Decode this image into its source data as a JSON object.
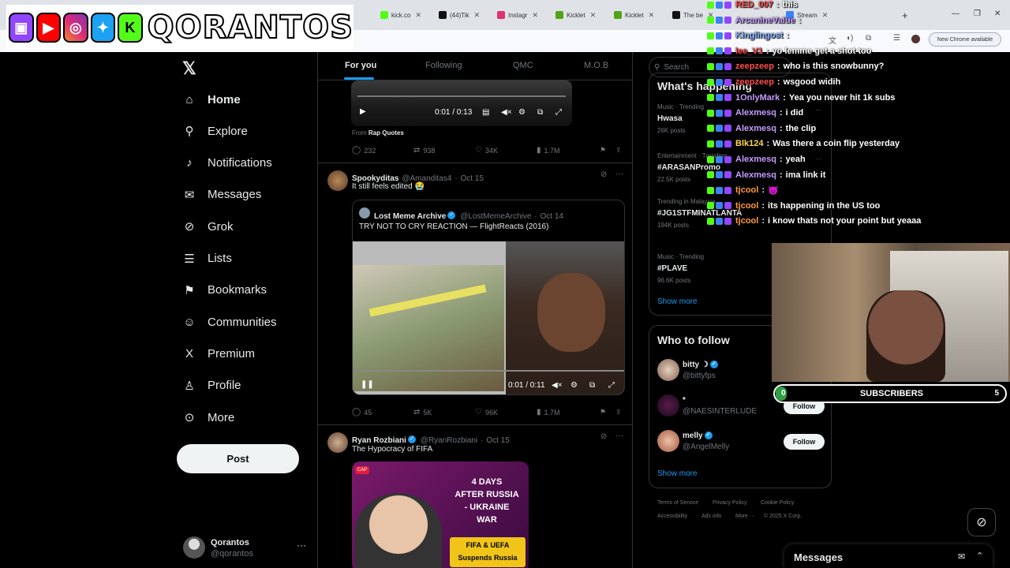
{
  "browser": {
    "tabs": [
      {
        "title": "kick.co",
        "color": "#53fc18"
      },
      {
        "title": "(44)Tik",
        "color": "#111111"
      },
      {
        "title": "Instagr",
        "color": "#e1306c"
      },
      {
        "title": "Kicklet",
        "color": "#53a318"
      },
      {
        "title": "Kicklet",
        "color": "#53a318"
      },
      {
        "title": "The be",
        "color": "#111111"
      },
      {
        "title": "Stream",
        "color": "#3b82f6"
      }
    ],
    "new_chrome_label": "New Chrome available"
  },
  "stream_overlay": {
    "logo_text": "QORANTOS"
  },
  "nav": {
    "items": [
      {
        "label": "Home",
        "icon": "home-icon",
        "glyph": "⌂"
      },
      {
        "label": "Explore",
        "icon": "search-icon",
        "glyph": "⚲"
      },
      {
        "label": "Notifications",
        "icon": "bell-icon",
        "glyph": "♪"
      },
      {
        "label": "Messages",
        "icon": "envelope-icon",
        "glyph": "✉"
      },
      {
        "label": "Grok",
        "icon": "grok-icon",
        "glyph": "⊘"
      },
      {
        "label": "Lists",
        "icon": "list-icon",
        "glyph": "☰"
      },
      {
        "label": "Bookmarks",
        "icon": "bookmark-icon",
        "glyph": "⚑"
      },
      {
        "label": "Communities",
        "icon": "communities-icon",
        "glyph": "☺"
      },
      {
        "label": "Premium",
        "icon": "x-premium-icon",
        "glyph": "X"
      },
      {
        "label": "Profile",
        "icon": "person-icon",
        "glyph": "♙"
      },
      {
        "label": "More",
        "icon": "more-circle-icon",
        "glyph": "⊙"
      }
    ],
    "post_label": "Post",
    "account": {
      "name": "Qorantos",
      "handle": "@qorantos"
    }
  },
  "feed": {
    "tabs": [
      "For you",
      "Following",
      "QMC",
      "M.O.B"
    ],
    "post1": {
      "video_time": "0:01 / 0:13",
      "from_prefix": "From",
      "from_source": "Rap Quotes",
      "replies": "232",
      "reposts": "938",
      "likes": "34K",
      "views": "1.7M"
    },
    "post2": {
      "name": "Spookyditas",
      "handle": "@Amanditas4",
      "date": "Oct 15",
      "text": "It still feels edited 😭",
      "quote": {
        "name": "Lost Meme Archive",
        "handle": "@LostMemeArchive",
        "date": "Oct 14",
        "text": "TRY NOT TO CRY REACTION — FlightReacts (2016)"
      },
      "video_time": "0:01 / 0:11",
      "replies": "45",
      "reposts": "5K",
      "likes": "96K",
      "views": "1.7M"
    },
    "post3": {
      "name": "Ryan Rozbiani",
      "handle": "@RyanRozbiani",
      "date": "Oct 15",
      "text": "The Hypocracy of FIFA",
      "image_lines": [
        "4 DAYS",
        "AFTER RUSSIA",
        "- UKRAINE",
        "WAR"
      ],
      "image_caption": [
        "FIFA & UEFA",
        "Suspends Russia"
      ]
    }
  },
  "right": {
    "search_placeholder": "Search",
    "trends_title": "What's happening",
    "trends": [
      {
        "meta": "Music · Trending",
        "name": "Hwasa",
        "posts": "26K posts"
      },
      {
        "meta": "Entertainment · Trending",
        "name": "#ARASANPromo",
        "posts": "22.5K posts"
      },
      {
        "meta": "Trending in Malaysia",
        "name": "#JG1STFMINATLANTA",
        "posts": "194K posts"
      },
      {
        "meta": "Music · Trending",
        "name": "#PLAVE",
        "posts": "96.6K posts"
      }
    ],
    "show_more": "Show more",
    "follow_title": "Who to follow",
    "follow": [
      {
        "name": "bitty ☽",
        "handle": "@bittyfps"
      },
      {
        "name": "*",
        "handle": "@NAESINTERLUDE",
        "button": "Follow"
      },
      {
        "name": "melly",
        "handle": "@AngelMelly",
        "button": "Follow"
      }
    ],
    "footer": [
      "Terms of Service",
      "Privacy Policy",
      "Cookie Policy",
      "Accessibility",
      "Ads info",
      "More ···",
      "© 2025 X Corp."
    ]
  },
  "chat": [
    {
      "user": "RED_007",
      "color": "#ff4d4d",
      "msg": "this"
    },
    {
      "user": "ArcanineValue",
      "color": "#c79bff",
      "msg": ""
    },
    {
      "user": "Kinglingost",
      "color": "#8ab4ff",
      "msg": ""
    },
    {
      "user": "lee_V1",
      "color": "#ff4d4d",
      "msg": "yo lemme get a shot too"
    },
    {
      "user": "zeepzeep",
      "color": "#ff4d4d",
      "msg": "who is this snowbunny?"
    },
    {
      "user": "zeepzeep",
      "color": "#ff4d4d",
      "msg": "wsgood widih"
    },
    {
      "user": "1OnlyMark",
      "color": "#c79bff",
      "msg": "Yea          you never hit 1k subs"
    },
    {
      "user": "Alexmesq",
      "color": "#c79bff",
      "msg": "i did"
    },
    {
      "user": "Alexmesq",
      "color": "#c79bff",
      "msg": "the clip"
    },
    {
      "user": "Blk124",
      "color": "#ffd84d",
      "msg": "Was there a coin flip yesterday"
    },
    {
      "user": "Alexmesq",
      "color": "#c79bff",
      "msg": "yeah"
    },
    {
      "user": "Alexmesq",
      "color": "#c79bff",
      "msg": "ima link it"
    },
    {
      "user": "tjcool",
      "color": "#ff9a3c",
      "msg": "😈"
    },
    {
      "user": "tjcool",
      "color": "#ff9a3c",
      "msg": "its happening in the US too"
    },
    {
      "user": "tjcool",
      "color": "#ff9a3c",
      "msg": "i know thats not your point but yeaaa"
    }
  ],
  "subs": {
    "current": "0",
    "label": "SUBSCRIBERS",
    "goal": "5",
    "progress": 0.03
  },
  "messages_drawer": {
    "title": "Messages"
  }
}
